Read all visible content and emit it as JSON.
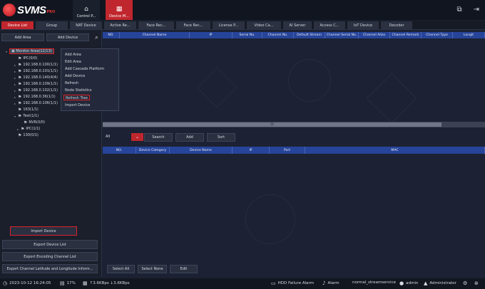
{
  "app": {
    "logo_text": "SVMS",
    "logo_sup": "PRO"
  },
  "nav": {
    "control_panel": "Control P...",
    "device_management": "Device M..."
  },
  "window": {
    "restore_icon": "restore-icon",
    "exit_icon": "exit-icon"
  },
  "subtabs": [
    "Device List",
    "Group",
    "NAT Device",
    "Active Re...",
    "Face Rec...",
    "Face Rec...",
    "License P...",
    "Video Ca...",
    "AI Server",
    "Access C...",
    "IoT Device",
    "Decoder"
  ],
  "sidebar": {
    "add_area": "Add Area",
    "add_device": "Add Device",
    "tree": [
      {
        "label": "Monitor Area(12/13)",
        "icon": "monitor-icon",
        "expand": "▾"
      },
      {
        "label": "IPC(0/0)",
        "icon": "device-icon",
        "expand": ""
      },
      {
        "label": "192.168.0.100(1/1)",
        "icon": "device-icon",
        "expand": "▸"
      },
      {
        "label": "192.168.0.101(1/1)",
        "icon": "device-icon",
        "expand": "▸"
      },
      {
        "label": "192.168.0.140(4/4)",
        "icon": "device-icon",
        "expand": "▸"
      },
      {
        "label": "192.168.0.109(1/1)",
        "icon": "device-icon",
        "expand": "▸"
      },
      {
        "label": "192.168.0.102(1/1)",
        "icon": "device-icon",
        "expand": "▸"
      },
      {
        "label": "192.168.0.36(1/1)",
        "icon": "device-icon",
        "expand": "▸"
      },
      {
        "label": "192.168.0.106(1/1)",
        "icon": "device-icon",
        "expand": "▸"
      },
      {
        "label": "163(1/1)",
        "icon": "device-icon",
        "expand": ""
      },
      {
        "label": "Test(1/1)",
        "icon": "device-icon",
        "expand": "▾"
      },
      {
        "label": "NVR(0/0)",
        "icon": "device-icon",
        "expand": ""
      },
      {
        "label": "IPC(1/1)",
        "icon": "device-icon",
        "expand": "▸"
      },
      {
        "label": "130(0/1)",
        "icon": "device-icon",
        "expand": ""
      }
    ],
    "import_device": "Import Device",
    "export_device_list": "Export Device List",
    "export_encoding_channel_list": "Export Encoding Channel List",
    "export_lat_long": "Export Channel Latitude and Longitude Inform..."
  },
  "context_menu": [
    "Add Area",
    "Edit Area",
    "Add Cascade Platform",
    "Add Device",
    "Refresh",
    "Node Statistics",
    "Refresh Tree",
    "Import Device"
  ],
  "channel_table": {
    "headers": [
      "NO.",
      "Channel Name",
      "IP",
      "Serial No.",
      "Channel No.",
      "Default Stream",
      "Channel Serial No.",
      "Channel Alias",
      "Channel Remark",
      "Channel Type",
      "Longit"
    ]
  },
  "scroll_label": "III",
  "filter": {
    "selected": "All",
    "search": "Search",
    "add": "Add",
    "sort": "Sort"
  },
  "device_table": {
    "headers": [
      "NO.",
      "Device Category",
      "Device Name",
      "IP",
      "Port",
      "MAC"
    ]
  },
  "bottom_buttons": {
    "select_all": "Select All",
    "select_none": "Select None",
    "edit": "Edit"
  },
  "status": {
    "datetime": "2023-10-12 16:24:05",
    "cpu": "17%",
    "upload": "↑3.6KBps",
    "download": "↓3.6KBps",
    "hdd": "HDD Failure Alarm",
    "alarm": "Alarm",
    "service": "normal_streamservice",
    "user": "admin",
    "role": "Administrator"
  },
  "colors": {
    "accent": "#c0262d",
    "header": "#26449a"
  }
}
